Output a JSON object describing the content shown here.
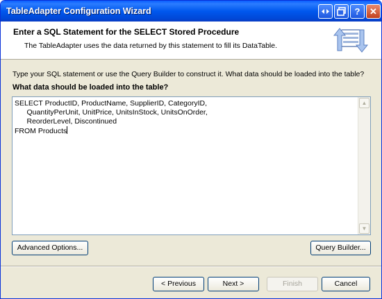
{
  "window": {
    "title": "TableAdapter Configuration Wizard"
  },
  "titlebar_buttons": {
    "help": "?",
    "close": "✕"
  },
  "header": {
    "title": "Enter a SQL Statement for the SELECT Stored Procedure",
    "subtitle": "The TableAdapter uses the data returned by this statement to fill its DataTable."
  },
  "body": {
    "instruction": "Type your SQL statement or use the Query Builder to construct it. What data should be loaded into the table?",
    "prompt": "What data should be loaded into the table?",
    "sql_lines": [
      "SELECT ProductID, ProductName, SupplierID, CategoryID,",
      "      QuantityPerUnit, UnitPrice, UnitsInStock, UnitsOnOrder,",
      "      ReorderLevel, Discontinued",
      "FROM Products"
    ]
  },
  "buttons": {
    "advanced": "Advanced Options...",
    "query_builder": "Query Builder...",
    "previous": "< Previous",
    "next": "Next >",
    "finish": "Finish",
    "cancel": "Cancel"
  }
}
